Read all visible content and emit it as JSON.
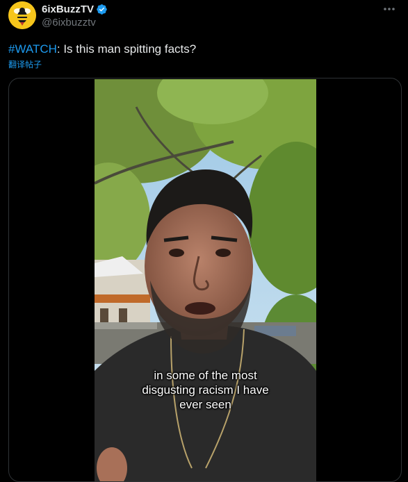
{
  "tweet": {
    "display_name": "6ixBuzzTV",
    "handle": "@6ixbuzztv",
    "hashtag": "#WATCH",
    "text": ": Is this man spitting facts?",
    "translate_label": "翻译帖子"
  },
  "video": {
    "caption_lines": [
      "in some of the most",
      "disgusting racism I have",
      "ever seen"
    ]
  },
  "icons": {
    "avatar": "bee-logo-avatar",
    "verified": "verified-badge-icon",
    "more": "more-options-icon"
  },
  "colors": {
    "background": "#000000",
    "text": "#e7e9ea",
    "secondary": "#71767b",
    "accent": "#1d9bf0",
    "avatar_bg": "#f6c51b"
  }
}
